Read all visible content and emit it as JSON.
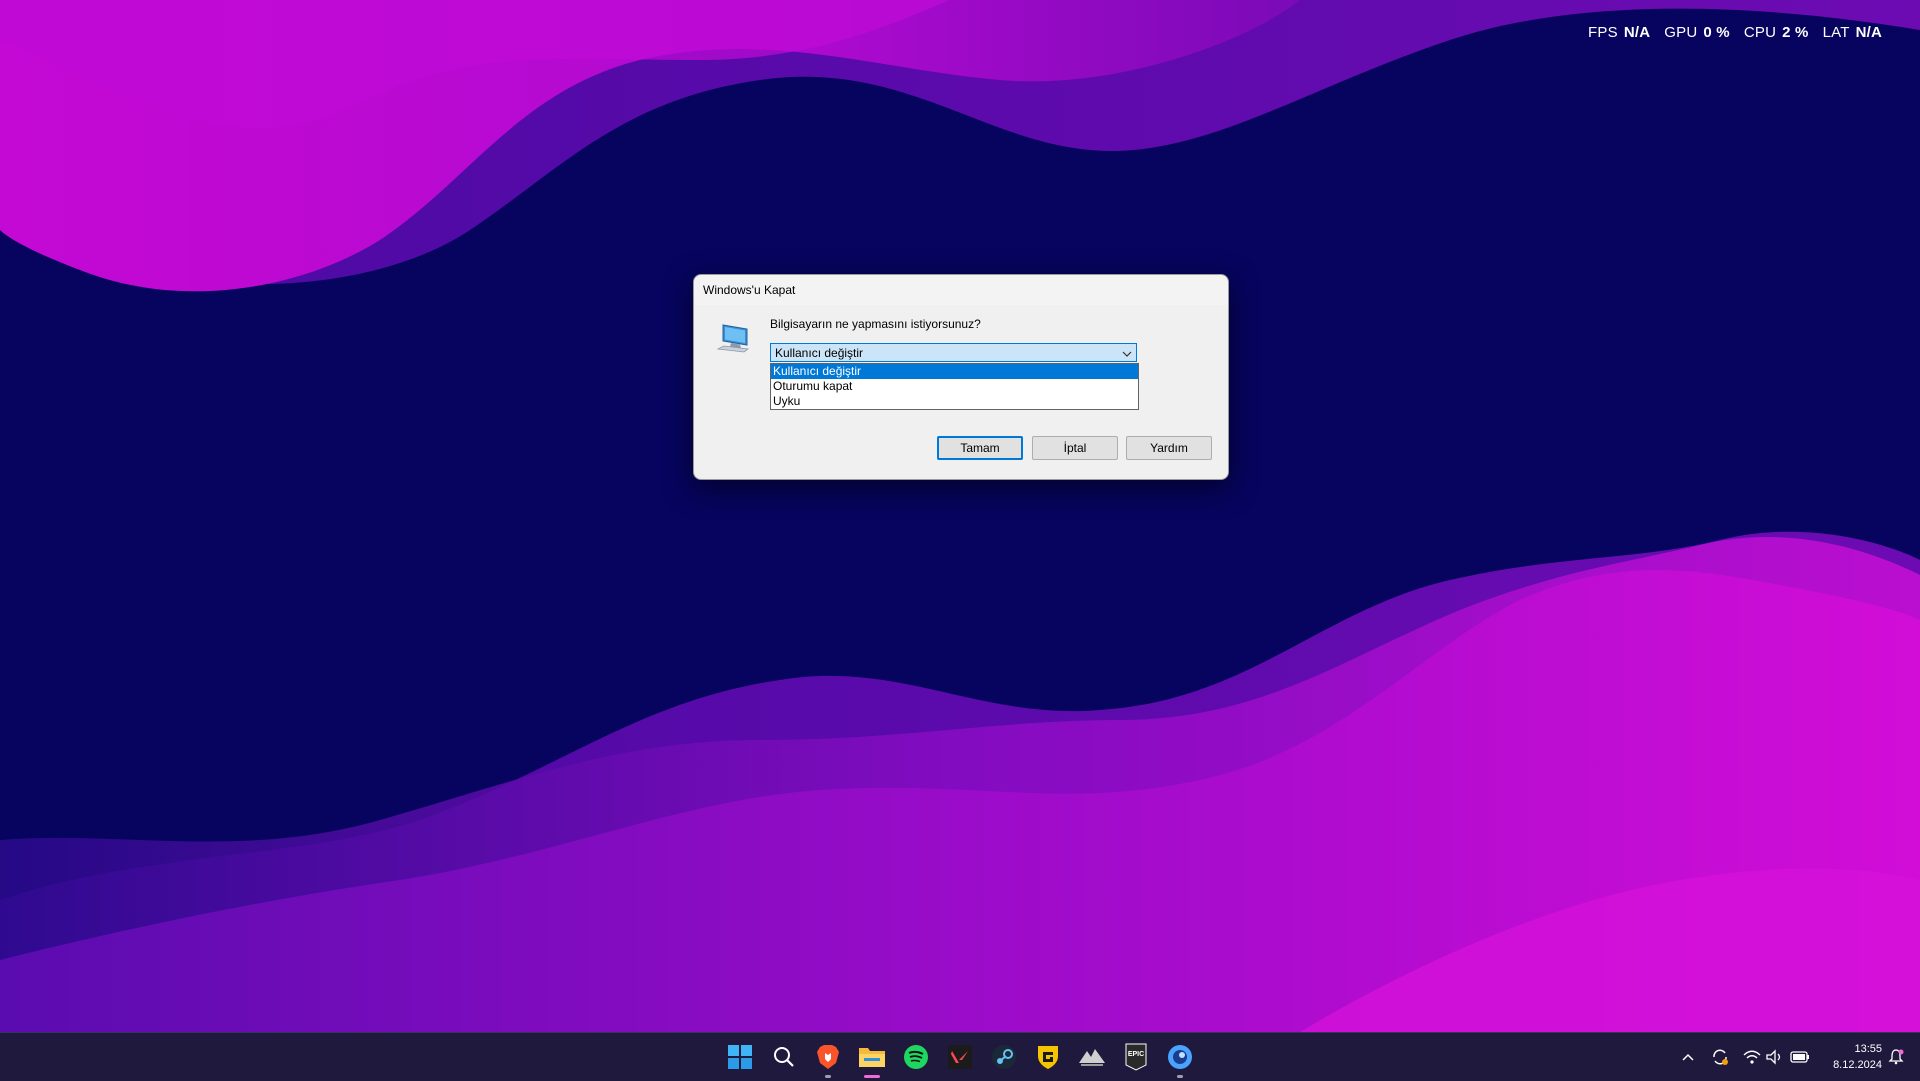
{
  "overlay": {
    "fps_label": "FPS",
    "fps_value": "N/A",
    "gpu_label": "GPU",
    "gpu_value": "0 %",
    "cpu_label": "CPU",
    "cpu_value": "2 %",
    "lat_label": "LAT",
    "lat_value": "N/A"
  },
  "dialog": {
    "title": "Windows'u Kapat",
    "question": "Bilgisayarın ne yapmasını istiyorsunuz?",
    "combo_value": "Kullanıcı değiştir",
    "options": [
      "Kullanıcı değiştir",
      "Oturumu kapat",
      "Uyku"
    ],
    "ok_label": "Tamam",
    "cancel_label": "İptal",
    "help_label": "Yardım"
  },
  "taskbar": {
    "icons": [
      "windows-start-icon",
      "search-icon",
      "brave-browser-icon",
      "file-explorer-icon",
      "spotify-icon",
      "valorant-icon",
      "steam-icon",
      "guard-shield-icon",
      "assassins-creed-icon",
      "epic-games-icon",
      "app-circle-icon"
    ],
    "clock_time": "13:55",
    "clock_date": "8.12.2024",
    "epic_text": "EPIC"
  },
  "colors": {
    "background": "#06045e",
    "wave_magenta": "#c90fd6",
    "wave_purple": "#7a0bb8",
    "accent": "#0078d7"
  }
}
